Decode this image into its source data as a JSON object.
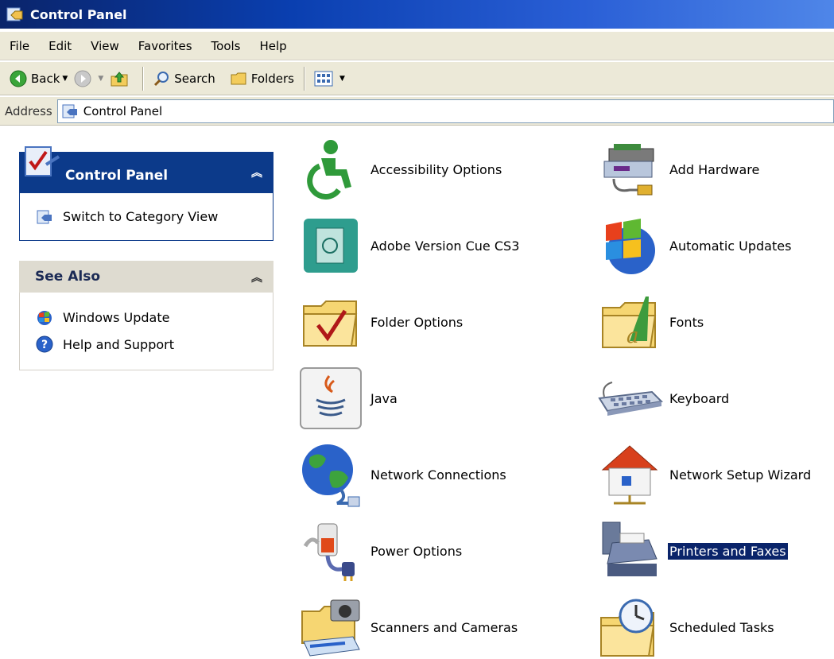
{
  "window": {
    "title": "Control Panel"
  },
  "menu": [
    "File",
    "Edit",
    "View",
    "Favorites",
    "Tools",
    "Help"
  ],
  "toolbar": {
    "back": "Back",
    "search": "Search",
    "folders": "Folders"
  },
  "address": {
    "label": "Address",
    "value": "Control Panel"
  },
  "taskpane": {
    "control_panel": {
      "title": "Control Panel",
      "link": "Switch to Category View"
    },
    "see_also": {
      "title": "See Also",
      "links": [
        "Windows Update",
        "Help and Support"
      ]
    }
  },
  "items": [
    {
      "label": "Accessibility Options",
      "icon": "accessibility-icon"
    },
    {
      "label": "Add Hardware",
      "icon": "add-hardware-icon"
    },
    {
      "label": "Adobe Version Cue CS3",
      "icon": "adobe-version-cue-icon"
    },
    {
      "label": "Automatic Updates",
      "icon": "automatic-updates-icon"
    },
    {
      "label": "Folder Options",
      "icon": "folder-options-icon"
    },
    {
      "label": "Fonts",
      "icon": "fonts-icon"
    },
    {
      "label": "Java",
      "icon": "java-icon"
    },
    {
      "label": "Keyboard",
      "icon": "keyboard-icon"
    },
    {
      "label": "Network Connections",
      "icon": "network-connections-icon"
    },
    {
      "label": "Network Setup Wizard",
      "icon": "network-setup-wizard-icon"
    },
    {
      "label": "Power Options",
      "icon": "power-options-icon"
    },
    {
      "label": "Printers and Faxes",
      "icon": "printers-faxes-icon",
      "selected": true
    },
    {
      "label": "Scanners and Cameras",
      "icon": "scanners-cameras-icon"
    },
    {
      "label": "Scheduled Tasks",
      "icon": "scheduled-tasks-icon"
    }
  ],
  "colors": {
    "titlebar": "#0a3fb0",
    "chrome": "#ece9d8",
    "panel_header": "#0c3a8a",
    "selection": "#0a246a"
  }
}
